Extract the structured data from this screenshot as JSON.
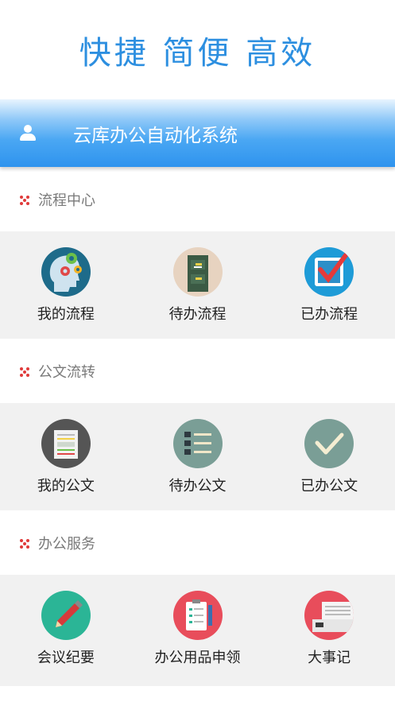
{
  "slogan": "快捷  简便  高效",
  "banner": {
    "title": "云库办公自动化系统",
    "icon": "user-icon"
  },
  "sections": [
    {
      "title": "流程中心",
      "items": [
        {
          "label": "我的流程",
          "icon": "head-gears-icon",
          "color": "#1e6b8a"
        },
        {
          "label": "待办流程",
          "icon": "file-cabinet-icon",
          "color": "#e7d3c0"
        },
        {
          "label": "已办流程",
          "icon": "checkbox-icon",
          "color": "#1e9bd7"
        }
      ]
    },
    {
      "title": "公文流转",
      "items": [
        {
          "label": "我的公文",
          "icon": "document-icon",
          "color": "#555555"
        },
        {
          "label": "待办公文",
          "icon": "list-icon",
          "color": "#7a9e96"
        },
        {
          "label": "已办公文",
          "icon": "checkmark-icon",
          "color": "#7a9e96"
        }
      ]
    },
    {
      "title": "办公服务",
      "items": [
        {
          "label": "会议纪要",
          "icon": "pencil-icon",
          "color": "#2bb596"
        },
        {
          "label": "办公用品申领",
          "icon": "clipboard-icon",
          "color": "#e84d5b"
        },
        {
          "label": "大事记",
          "icon": "printer-icon",
          "color": "#e84d5b"
        }
      ]
    }
  ]
}
